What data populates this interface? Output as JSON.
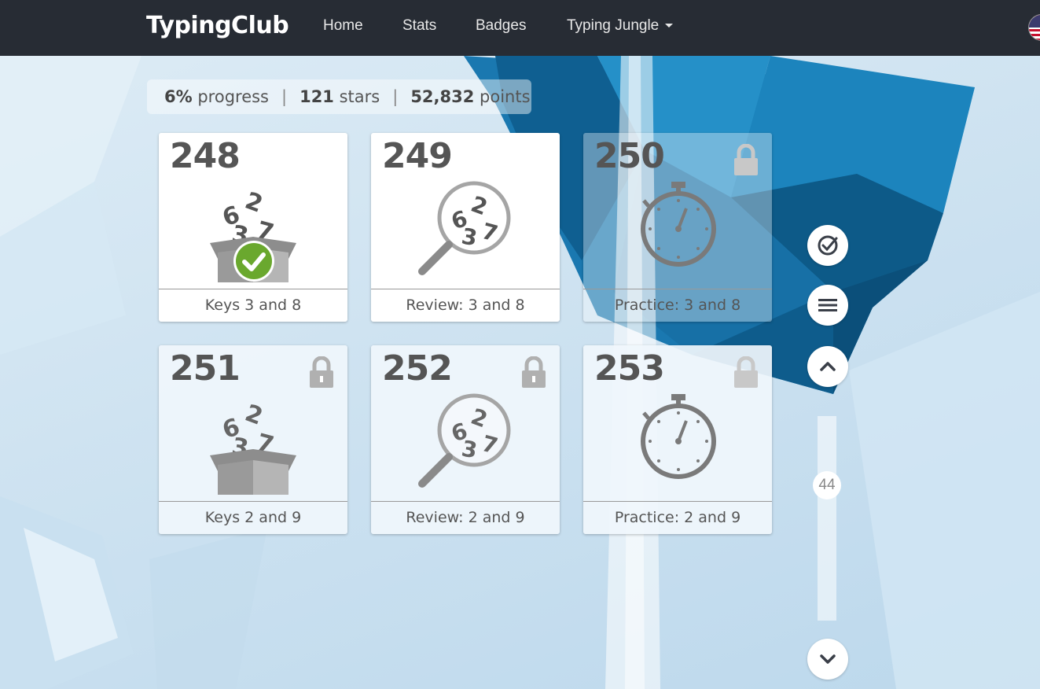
{
  "navbar": {
    "brand": "TypingClub",
    "items": [
      {
        "label": "Home"
      },
      {
        "label": "Stats"
      },
      {
        "label": "Badges"
      },
      {
        "label": "Typing Jungle"
      }
    ]
  },
  "progress": {
    "percent": "6%",
    "percent_label": "progress",
    "stars": "121",
    "stars_label": "stars",
    "points": "52,832",
    "points_label": "points"
  },
  "lessons": [
    {
      "number": "248",
      "title": "Keys 3 and 8",
      "icon": "box-icon",
      "status": "completed"
    },
    {
      "number": "249",
      "title": "Review: 3 and 8",
      "icon": "magnifier-icon",
      "status": "open"
    },
    {
      "number": "250",
      "title": "Practice: 3 and 8",
      "icon": "stopwatch-icon",
      "status": "locked"
    },
    {
      "number": "251",
      "title": "Keys 2 and 9",
      "icon": "box-icon",
      "status": "locked"
    },
    {
      "number": "252",
      "title": "Review: 2 and 9",
      "icon": "magnifier-icon",
      "status": "locked"
    },
    {
      "number": "253",
      "title": "Practice: 2 and 9",
      "icon": "stopwatch-icon",
      "status": "locked"
    }
  ],
  "sidebar": {
    "scroll_value": "44",
    "buttons": [
      "check-circle-icon",
      "menu-icon",
      "chevron-up-icon",
      "chevron-down-icon"
    ]
  },
  "colors": {
    "navbar_bg": "#272c34",
    "card_text": "#555555",
    "check_green": "#6aa82e",
    "crystal_blue": "#1f7fb8"
  }
}
